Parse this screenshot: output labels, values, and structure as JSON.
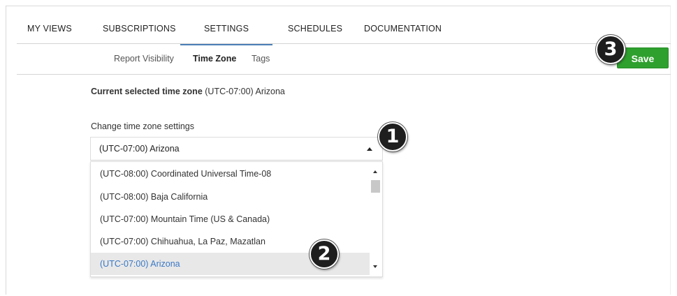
{
  "main_tabs": [
    {
      "label": "MY VIEWS",
      "active": false
    },
    {
      "label": "SUBSCRIPTIONS",
      "active": false
    },
    {
      "label": "SETTINGS",
      "active": true
    },
    {
      "label": "SCHEDULES",
      "active": false
    },
    {
      "label": "DOCUMENTATION",
      "active": false
    }
  ],
  "sub_tabs": [
    {
      "label": "Report Visibility",
      "active": false
    },
    {
      "label": "Time Zone",
      "active": true
    },
    {
      "label": "Tags",
      "active": false
    }
  ],
  "toolbar": {
    "save_label": "Save"
  },
  "time_zone": {
    "current_label": "Current selected time zone",
    "current_value": "(UTC-07:00) Arizona",
    "change_label": "Change time zone settings",
    "select_value": "(UTC-07:00) Arizona",
    "options": [
      {
        "label": "(UTC-08:00) Coordinated Universal Time-08",
        "selected": false
      },
      {
        "label": "(UTC-08:00) Baja California",
        "selected": false
      },
      {
        "label": "(UTC-07:00) Mountain Time (US & Canada)",
        "selected": false
      },
      {
        "label": "(UTC-07:00) Chihuahua, La Paz, Mazatlan",
        "selected": false
      },
      {
        "label": "(UTC-07:00) Arizona",
        "selected": true
      }
    ]
  },
  "callouts": {
    "one": "1",
    "two": "2",
    "three": "3"
  },
  "colors": {
    "accent": "#4a7fb5",
    "save_green": "#2ea02e",
    "selected_text": "#3b78c4",
    "selected_bg": "#e8e8e8"
  },
  "icons": {
    "select_arrow": "caret-up-icon",
    "scroll_up": "scroll-up-icon",
    "scroll_down": "scroll-down-icon"
  }
}
